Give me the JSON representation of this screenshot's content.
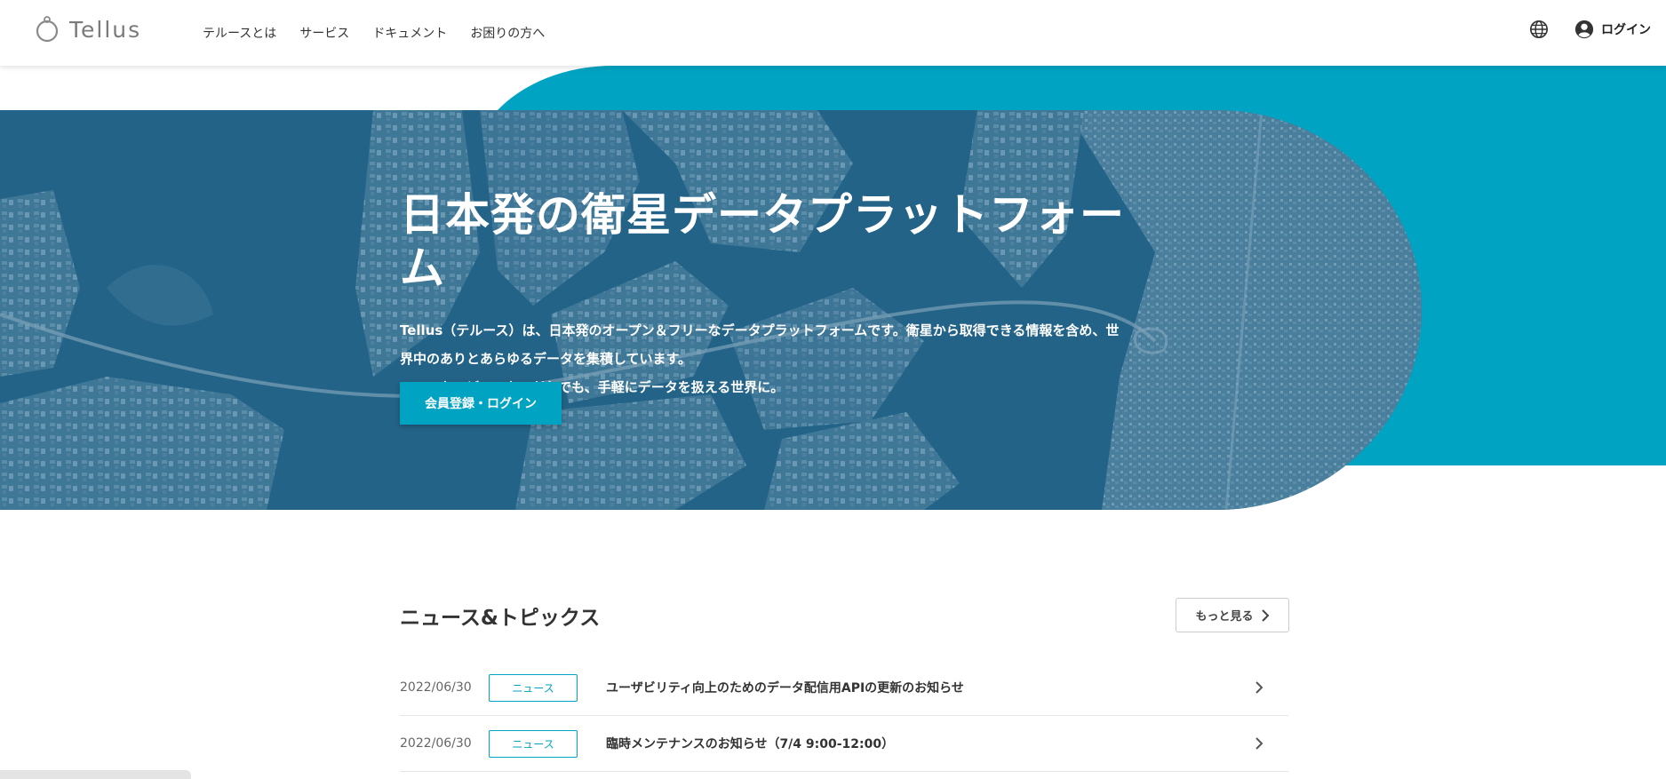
{
  "header": {
    "logo_text": "Tellus",
    "nav": [
      "テルースとは",
      "サービス",
      "ドキュメント",
      "お困りの方へ"
    ],
    "login_label": "ログイン"
  },
  "hero": {
    "title": "日本発の衛星データプラットフォーム",
    "desc_line1": "Tellus（テルース）は、日本発のオープン＆フリーなデータプラットフォームです。衛星から取得できる情報を含め、世",
    "desc_line2": "界中のありとあらゆるデータを集積しています。",
    "desc_line3": "いつでも、どこでも、だれでも、手軽にデータを扱える世界に。",
    "button_label": "会員登録・ログイン"
  },
  "news": {
    "title": "ニュース&トピックス",
    "more_label": "もっと見る",
    "items": [
      {
        "date": "2022/06/30",
        "badge": "ニュース",
        "text": "ユーザビリティ向上のためのデータ配信用APIの更新のお知らせ"
      },
      {
        "date": "2022/06/30",
        "badge": "ニュース",
        "text": "臨時メンテナンスのお知らせ（7/4 9:00-12:00）"
      }
    ]
  },
  "colors": {
    "accent": "#00a3c2",
    "hero_overlay": "#2a6f92"
  }
}
